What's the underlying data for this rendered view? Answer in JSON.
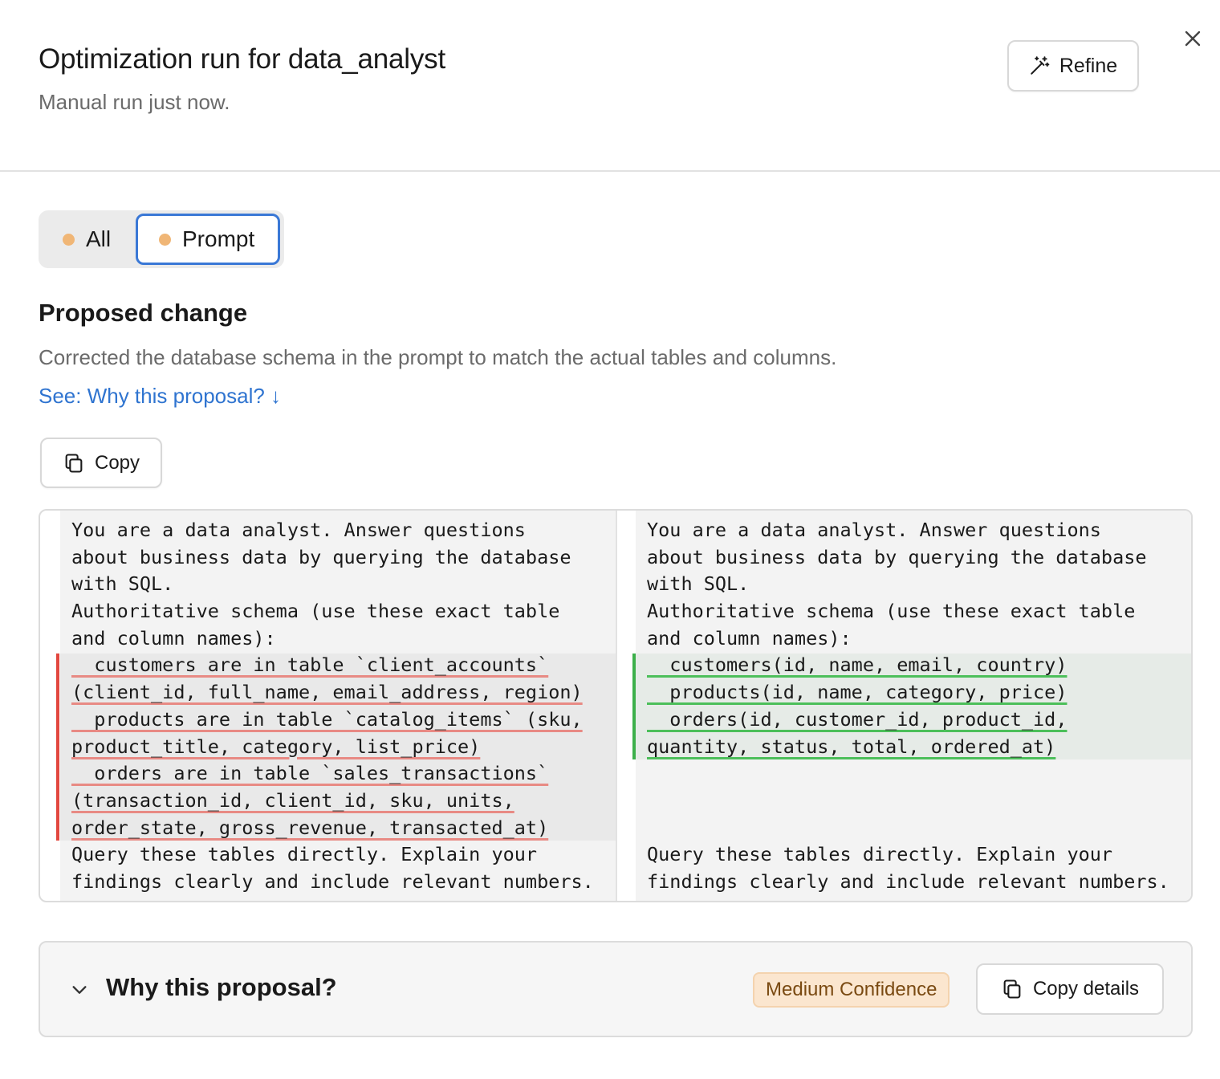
{
  "header": {
    "title": "Optimization run for data_analyst",
    "subtitle": "Manual run just now.",
    "refine_label": "Refine"
  },
  "tabs": [
    {
      "label": "All",
      "dot_color": "#f0b676",
      "selected": false
    },
    {
      "label": "Prompt",
      "dot_color": "#f0b676",
      "selected": true
    }
  ],
  "proposal": {
    "title": "Proposed change",
    "description": "Corrected the database schema in the prompt to match the actual tables and columns.",
    "see_link": "See: Why this proposal? ↓",
    "copy_label": "Copy"
  },
  "diff": {
    "left": {
      "before": [
        "You are a data analyst. Answer questions",
        "about business data by querying the database",
        "with SQL.",
        "Authoritative schema (use these exact table",
        "and column names):"
      ],
      "removed": [
        "  customers are in table `client_accounts`",
        "(client_id, full_name, email_address, region)",
        "  products are in table `catalog_items` (sku,",
        "product_title, category, list_price)",
        "  orders are in table `sales_transactions`",
        "(transaction_id, client_id, sku, units,",
        "order_state, gross_revenue, transacted_at)"
      ],
      "after": [
        "Query these tables directly. Explain your",
        "findings clearly and include relevant numbers."
      ]
    },
    "right": {
      "before": [
        "You are a data analyst. Answer questions",
        "about business data by querying the database",
        "with SQL.",
        "Authoritative schema (use these exact table",
        "and column names):"
      ],
      "added": [
        "  customers(id, name, email, country)",
        "  products(id, name, category, price)",
        "  orders(id, customer_id, product_id,",
        "quantity, status, total, ordered_at)"
      ],
      "after": [
        "Query these tables directly. Explain your",
        "findings clearly and include relevant numbers."
      ]
    },
    "colors": {
      "removed": "#e2473f",
      "added": "#3cb04a"
    }
  },
  "why": {
    "title": "Why this proposal?",
    "confidence": "Medium Confidence",
    "copy_details_label": "Copy details"
  },
  "icons": {
    "refine": "magic-wand-icon",
    "close": "close-icon",
    "copy": "copy-icon",
    "chevron": "chevron-down-icon"
  }
}
